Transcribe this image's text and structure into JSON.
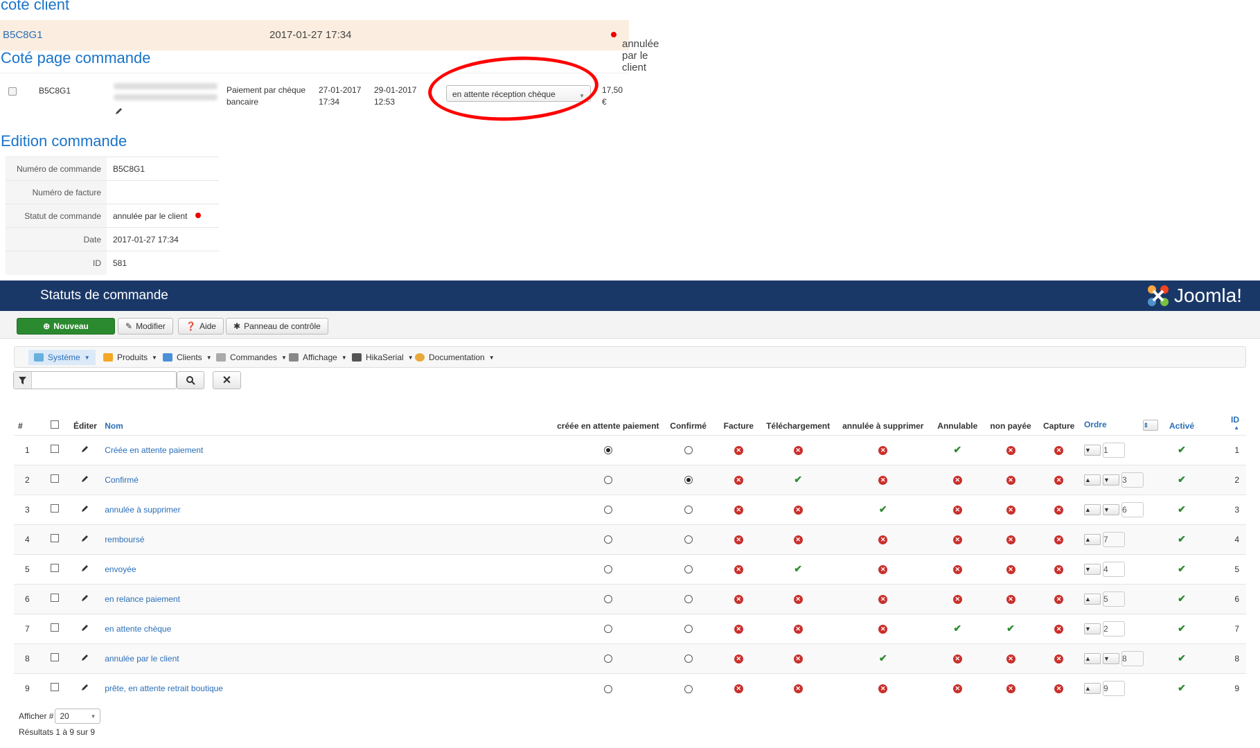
{
  "sections": {
    "client": "coté client",
    "order_page": "Coté page commande",
    "edit": "Edition commande"
  },
  "client_row": {
    "ref": "B5C8G1",
    "date": "2017-01-27 17:34",
    "status": "annulée par le client"
  },
  "order_row": {
    "ref": "B5C8G1",
    "payment_line1": "Paiement par chèque",
    "payment_line2": "bancaire",
    "date1_line1": "27-01-2017",
    "date1_line2": "17:34",
    "date2_line1": "29-01-2017",
    "date2_line2": "12:53",
    "status_select": "en attente réception chèque",
    "price_line1": "17,50",
    "price_line2": "€"
  },
  "edit_table": [
    {
      "key": "Numéro de commande",
      "value": "B5C8G1"
    },
    {
      "key": "Numéro de facture",
      "value": ""
    },
    {
      "key": "Statut de commande",
      "value": "annulée par le client"
    },
    {
      "key": "Date",
      "value": "2017-01-27 17:34"
    },
    {
      "key": "ID",
      "value": "581"
    }
  ],
  "joomla": {
    "title": "Statuts de commande",
    "logo_text": "Joomla!",
    "toolbar": {
      "new": "Nouveau",
      "edit": "Modifier",
      "help": "Aide",
      "panel": "Panneau de contrôle"
    },
    "menu": [
      "Système",
      "Produits",
      "Clients",
      "Commandes",
      "Affichage",
      "HikaSerial",
      "Documentation"
    ],
    "filter_placeholder": "",
    "columns": {
      "num": "#",
      "edit": "Éditer",
      "name": "Nom",
      "c1": "créée en attente paiement",
      "c2": "Confirmé",
      "c3": "Facture",
      "c4": "Téléchargement",
      "c5": "annulée à supprimer",
      "c6": "Annulable",
      "c7": "non payée",
      "c8": "Capture",
      "order": "Ordre",
      "active": "Activé",
      "id": "ID"
    },
    "rows": [
      {
        "n": "1",
        "name": "Créée en attente paiement",
        "r1": true,
        "r2": false,
        "f": [
          0,
          0,
          0,
          1,
          0,
          0
        ],
        "up": false,
        "down": true,
        "ord": "1",
        "id": "1"
      },
      {
        "n": "2",
        "name": "Confirmé",
        "r1": false,
        "r2": true,
        "f": [
          0,
          1,
          0,
          0,
          0,
          0
        ],
        "up": true,
        "down": true,
        "ord": "3",
        "id": "2"
      },
      {
        "n": "3",
        "name": "annulée à supprimer",
        "r1": false,
        "r2": false,
        "f": [
          0,
          0,
          1,
          0,
          0,
          0
        ],
        "up": true,
        "down": true,
        "ord": "6",
        "id": "3"
      },
      {
        "n": "4",
        "name": "remboursé",
        "r1": false,
        "r2": false,
        "f": [
          0,
          0,
          0,
          0,
          0,
          0
        ],
        "up": true,
        "down": false,
        "ord": "7",
        "id": "4"
      },
      {
        "n": "5",
        "name": "envoyée",
        "r1": false,
        "r2": false,
        "f": [
          0,
          1,
          0,
          0,
          0,
          0
        ],
        "up": false,
        "down": true,
        "ord": "4",
        "id": "5"
      },
      {
        "n": "6",
        "name": "en relance paiement",
        "r1": false,
        "r2": false,
        "f": [
          0,
          0,
          0,
          0,
          0,
          0
        ],
        "up": true,
        "down": false,
        "ord": "5",
        "id": "6"
      },
      {
        "n": "7",
        "name": "en attente chèque",
        "r1": false,
        "r2": false,
        "f": [
          0,
          0,
          0,
          1,
          1,
          0
        ],
        "up": false,
        "down": true,
        "ord": "2",
        "id": "7"
      },
      {
        "n": "8",
        "name": "annulée par le client",
        "r1": false,
        "r2": false,
        "f": [
          0,
          0,
          1,
          0,
          0,
          0
        ],
        "up": true,
        "down": true,
        "ord": "8",
        "id": "8"
      },
      {
        "n": "9",
        "name": "prête, en attente retrait boutique",
        "r1": false,
        "r2": false,
        "f": [
          0,
          0,
          0,
          0,
          0,
          0
        ],
        "up": true,
        "down": false,
        "ord": "9",
        "id": "9"
      }
    ],
    "pager_label": "Afficher #",
    "pager_value": "20",
    "results": "Résultats 1 à 9 sur 9"
  },
  "colors": {
    "title_blue": "#1a73c8",
    "header_navy": "#1a3867",
    "green": "#2b8a2f",
    "red": "#c9302c",
    "annotation_red": "#ff0000"
  }
}
